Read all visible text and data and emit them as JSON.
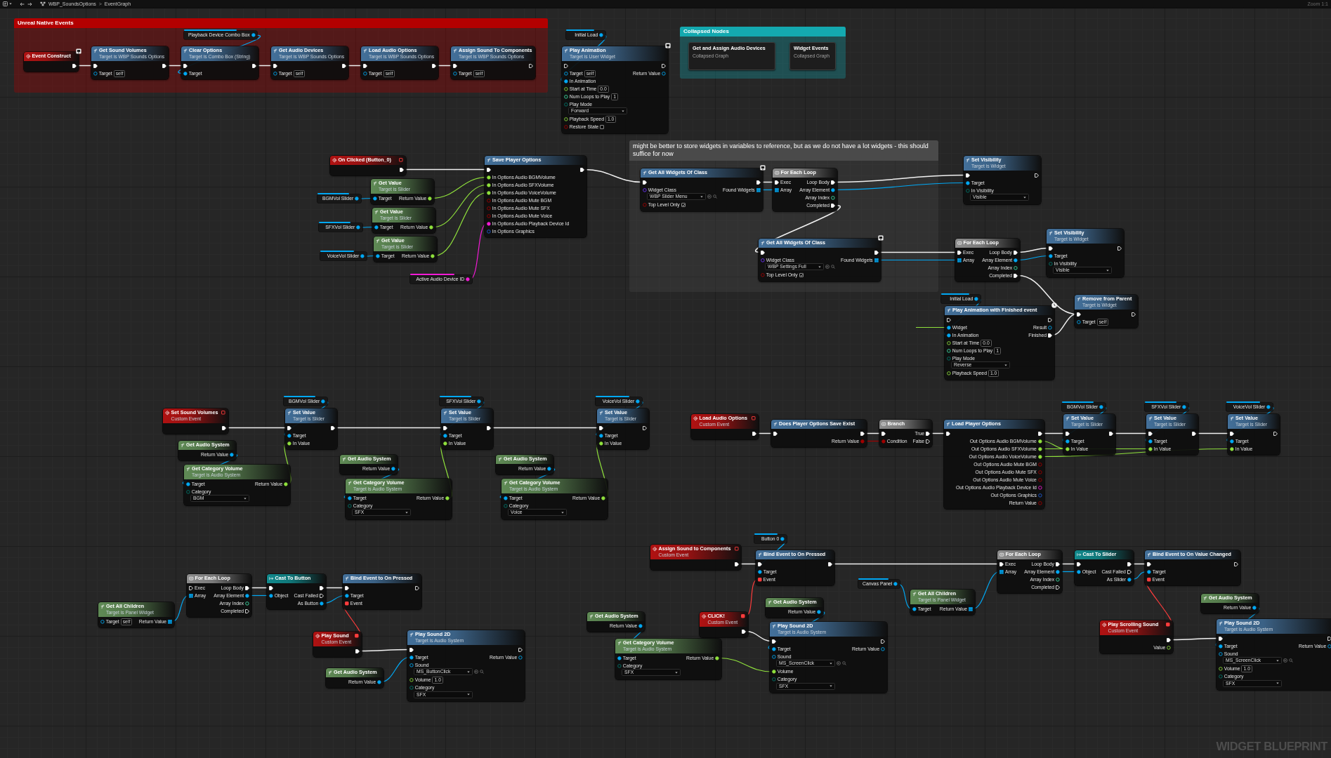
{
  "toolbar": {
    "path": [
      "WBP_SoundsOptions",
      "EventGraph"
    ],
    "separator": ">",
    "zoom": "Zoom 1:1"
  },
  "comments": [
    {
      "title": "Unreal Native Events",
      "color": "#b30000"
    },
    {
      "title": "Collapsed Nodes",
      "color": "#14a9b0"
    },
    {
      "title": "might be better to store widgets in variables to reference, but as we do not have a lot widgets - this should suffice for now",
      "color": "#4a4a4a"
    }
  ],
  "nodes": [
    {
      "kind": "event",
      "title": "Event Construct",
      "outputs": [
        {
          "kind": "exec",
          "linked": true
        }
      ]
    },
    {
      "kind": "function",
      "title": "Get Sound Volumes",
      "subtitle": "Target is WBP Sounds Options",
      "inputs": [
        {
          "kind": "exec",
          "linked": true
        },
        {
          "kind": "object",
          "label": "Target",
          "value": "self",
          "linked": false
        }
      ],
      "outputs": [
        {
          "kind": "exec",
          "linked": true
        }
      ]
    },
    {
      "kind": "getter",
      "title": "Playback Device Combo Box",
      "outputs": [
        {
          "kind": "object",
          "linked": true
        }
      ]
    },
    {
      "kind": "function",
      "title": "Clear Options",
      "subtitle": "Target is Combo Box (String)",
      "inputs": [
        {
          "kind": "exec",
          "linked": true
        },
        {
          "kind": "object",
          "label": "Target",
          "linked": true
        }
      ],
      "outputs": [
        {
          "kind": "exec",
          "linked": true
        }
      ]
    },
    {
      "kind": "function",
      "title": "Get Audio Devices",
      "subtitle": "Target is WBP Sounds Options",
      "inputs": [
        {
          "kind": "exec",
          "linked": true
        },
        {
          "kind": "object",
          "label": "Target",
          "value": "self",
          "linked": false
        }
      ],
      "outputs": [
        {
          "kind": "exec",
          "linked": true
        }
      ]
    },
    {
      "kind": "function",
      "title": "Load Audio Options",
      "subtitle": "Target is WBP Sounds Options",
      "inputs": [
        {
          "kind": "exec",
          "linked": true
        },
        {
          "kind": "object",
          "label": "Target",
          "value": "self",
          "linked": false
        }
      ],
      "outputs": [
        {
          "kind": "exec",
          "linked": true
        }
      ]
    },
    {
      "kind": "function",
      "title": "Assign Sound To Components",
      "subtitle": "Target is WBP Sounds Options",
      "inputs": [
        {
          "kind": "exec",
          "linked": true
        },
        {
          "kind": "object",
          "label": "Target",
          "value": "self",
          "linked": false
        }
      ],
      "outputs": [
        {
          "kind": "exec",
          "linked": false
        }
      ]
    },
    {
      "kind": "getter",
      "title": "Initial Load",
      "outputs": [
        {
          "kind": "object",
          "linked": true
        }
      ]
    },
    {
      "kind": "function",
      "title": "Play Animation",
      "subtitle": "Target is User Widget",
      "inputs": [
        {
          "kind": "exec",
          "linked": false
        },
        {
          "kind": "object",
          "label": "Target",
          "value": "self",
          "linked": false
        },
        {
          "kind": "object",
          "label": "In Animation",
          "linked": true
        },
        {
          "kind": "float",
          "label": "Start at Time",
          "value": "0.0",
          "linked": false
        },
        {
          "kind": "int",
          "label": "Num Loops to Play",
          "value": "1",
          "linked": false
        },
        {
          "kind": "enum",
          "label": "Play Mode",
          "value": "Forward",
          "linked": false
        },
        {
          "kind": "float",
          "label": "Playback Speed",
          "value": "1.0",
          "linked": false
        },
        {
          "kind": "bool",
          "label": "Restore State",
          "checked": false,
          "linked": false
        }
      ],
      "outputs": [
        {
          "kind": "exec",
          "linked": false
        },
        {
          "kind": "object",
          "label": "Return Value",
          "linked": false
        }
      ]
    },
    {
      "kind": "collapsed",
      "title": "Get and Assign Audio Devices",
      "subtitle": "Collapsed Graph"
    },
    {
      "kind": "collapsed",
      "title": "Widget Events",
      "subtitle": "Collapsed Graph"
    },
    {
      "kind": "event",
      "title": "On Clicked (Button_0)",
      "delegate": {
        "linked": false
      },
      "outputs": [
        {
          "kind": "exec",
          "linked": true
        }
      ]
    },
    {
      "kind": "getter",
      "title": "BGMVol Slider",
      "outputs": [
        {
          "kind": "object",
          "linked": true
        }
      ]
    },
    {
      "kind": "getter",
      "title": "SFXVol Slider",
      "outputs": [
        {
          "kind": "object",
          "linked": true
        }
      ]
    },
    {
      "kind": "getter",
      "title": "VoiceVol Slider",
      "outputs": [
        {
          "kind": "object",
          "linked": true
        }
      ]
    },
    {
      "kind": "pure",
      "title": "Get Value",
      "subtitle": "Target is Slider",
      "inputs": [
        {
          "kind": "object",
          "label": "Target",
          "linked": true
        }
      ],
      "outputs": [
        {
          "kind": "float",
          "label": "Return Value",
          "linked": true
        }
      ]
    },
    {
      "kind": "pure",
      "title": "Get Value",
      "subtitle": "Target is Slider",
      "inputs": [
        {
          "kind": "object",
          "label": "Target",
          "linked": true
        }
      ],
      "outputs": [
        {
          "kind": "float",
          "label": "Return Value",
          "linked": true
        }
      ]
    },
    {
      "kind": "pure",
      "title": "Get Value",
      "subtitle": "Target is Slider",
      "inputs": [
        {
          "kind": "object",
          "label": "Target",
          "linked": true
        }
      ],
      "outputs": [
        {
          "kind": "float",
          "label": "Return Value",
          "linked": true
        }
      ]
    },
    {
      "kind": "getter",
      "title": "Active Audio Device ID",
      "outputs": [
        {
          "kind": "string",
          "linked": true
        }
      ]
    },
    {
      "kind": "function",
      "title": "Save Player Options",
      "inputs": [
        {
          "kind": "exec",
          "linked": true
        },
        {
          "kind": "float",
          "label": "In Options Audio BGMVolume",
          "linked": true
        },
        {
          "kind": "float",
          "label": "In Options Audio SFXVolume",
          "linked": true
        },
        {
          "kind": "float",
          "label": "In Options Audio VoiceVolume",
          "linked": true
        },
        {
          "kind": "bool",
          "label": "In Options Audio Mute BGM",
          "linked": false
        },
        {
          "kind": "bool",
          "label": "In Options Audio Mute SFX",
          "linked": false
        },
        {
          "kind": "bool",
          "label": "In Options Audio Mute Voice",
          "linked": false
        },
        {
          "kind": "string",
          "label": "In Options Audio Playback Device Id",
          "linked": true
        },
        {
          "kind": "struct",
          "label": "In Options Graphics",
          "linked": false
        }
      ],
      "outputs": [
        {
          "kind": "exec",
          "linked": true
        }
      ]
    },
    {
      "kind": "function",
      "title": "Get All Widgets Of Class",
      "inputs": [
        {
          "kind": "exec",
          "linked": true
        },
        {
          "kind": "class",
          "label": "Widget Class",
          "value": "WBP Slider Menu",
          "linked": false
        },
        {
          "kind": "bool",
          "label": "Top Level Only",
          "checked": true,
          "linked": false
        }
      ],
      "outputs": [
        {
          "kind": "exec",
          "linked": true
        },
        {
          "kind": "array",
          "label": "Found Widgets",
          "linked": true
        }
      ]
    },
    {
      "kind": "macro",
      "title": "For Each Loop",
      "inputs": [
        {
          "kind": "exec",
          "label": "Exec",
          "linked": true
        },
        {
          "kind": "array",
          "label": "Array",
          "linked": true
        }
      ],
      "outputs": [
        {
          "kind": "exec",
          "label": "Loop Body",
          "linked": true
        },
        {
          "kind": "object",
          "label": "Array Element",
          "linked": true
        },
        {
          "kind": "int",
          "label": "Array Index",
          "linked": false
        },
        {
          "kind": "exec",
          "label": "Completed",
          "linked": true
        }
      ]
    },
    {
      "kind": "function",
      "title": "Get All Widgets Of Class",
      "inputs": [
        {
          "kind": "exec",
          "linked": true
        },
        {
          "kind": "class",
          "label": "Widget Class",
          "value": "WBP Settings Full",
          "linked": false
        },
        {
          "kind": "bool",
          "label": "Top Level Only",
          "checked": true,
          "linked": false
        }
      ],
      "outputs": [
        {
          "kind": "exec",
          "linked": true
        },
        {
          "kind": "array",
          "label": "Found Widgets",
          "linked": true
        }
      ]
    },
    {
      "kind": "function",
      "title": "Set Visibility",
      "subtitle": "Target is Widget",
      "inputs": [
        {
          "kind": "exec",
          "linked": true
        },
        {
          "kind": "object",
          "label": "Target",
          "linked": true
        },
        {
          "kind": "enum",
          "label": "In Visibility",
          "value": "Visible",
          "linked": false
        }
      ],
      "outputs": [
        {
          "kind": "exec",
          "linked": false
        }
      ]
    },
    {
      "kind": "macro",
      "title": "For Each Loop",
      "inputs": [
        {
          "kind": "exec",
          "label": "Exec",
          "linked": true
        },
        {
          "kind": "array",
          "label": "Array",
          "linked": true
        }
      ],
      "outputs": [
        {
          "kind": "exec",
          "label": "Loop Body",
          "linked": true
        },
        {
          "kind": "object",
          "label": "Array Element",
          "linked": true
        },
        {
          "kind": "int",
          "label": "Array Index",
          "linked": false
        },
        {
          "kind": "exec",
          "label": "Completed",
          "linked": true
        }
      ]
    },
    {
      "kind": "function",
      "title": "Set Visibility",
      "subtitle": "Target is Widget",
      "inputs": [
        {
          "kind": "exec",
          "linked": true
        },
        {
          "kind": "object",
          "label": "Target",
          "linked": true
        },
        {
          "kind": "enum",
          "label": "In Visibility",
          "value": "Visible",
          "linked": false
        }
      ],
      "outputs": [
        {
          "kind": "exec",
          "linked": false
        }
      ]
    },
    {
      "kind": "getter",
      "title": "Initial Load",
      "outputs": [
        {
          "kind": "object",
          "linked": true
        }
      ]
    },
    {
      "kind": "function",
      "title": "Play Animation with Finished event",
      "inputs": [
        {
          "kind": "exec",
          "linked": false
        },
        {
          "kind": "object",
          "label": "Widget",
          "linked": true
        },
        {
          "kind": "object",
          "label": "In Animation",
          "linked": true
        },
        {
          "kind": "float",
          "label": "Start at Time",
          "value": "0.0",
          "linked": false
        },
        {
          "kind": "int",
          "label": "Num Loops to Play",
          "value": "1",
          "linked": false
        },
        {
          "kind": "enum",
          "label": "Play Mode",
          "value": "Reverse",
          "linked": false
        },
        {
          "kind": "float",
          "label": "Playback Speed",
          "value": "1.0",
          "linked": false
        }
      ],
      "outputs": [
        {
          "kind": "exec",
          "linked": false
        },
        {
          "kind": "object",
          "label": "Result",
          "linked": false
        },
        {
          "kind": "exec",
          "label": "Finished",
          "linked": true
        }
      ]
    },
    {
      "kind": "function",
      "title": "Remove from Parent",
      "subtitle": "Target is Widget",
      "inputs": [
        {
          "kind": "exec",
          "linked": true
        },
        {
          "kind": "object",
          "label": "Target",
          "value": "self",
          "linked": false
        }
      ],
      "outputs": [
        {
          "kind": "exec",
          "linked": false
        }
      ]
    },
    {
      "kind": "event",
      "title": "Set Sound Volumes",
      "subtitle": "Custom Event",
      "delegate": {
        "linked": false
      },
      "outputs": [
        {
          "kind": "exec",
          "linked": true
        }
      ]
    },
    {
      "kind": "pure",
      "title": "Get Audio System",
      "outputs": [
        {
          "kind": "object",
          "label": "Return Value",
          "linked": true
        }
      ]
    },
    {
      "kind": "pure",
      "title": "Get Category Volume",
      "subtitle": "Target is Audio System",
      "inputs": [
        {
          "kind": "object",
          "label": "Target",
          "linked": true
        },
        {
          "kind": "enum",
          "label": "Category",
          "value": "BGM",
          "linked": false
        }
      ],
      "outputs": [
        {
          "kind": "float",
          "label": "Return Value",
          "linked": true
        }
      ]
    },
    {
      "kind": "getter",
      "title": "BGMVol Slider",
      "outputs": [
        {
          "kind": "object",
          "linked": true
        }
      ]
    },
    {
      "kind": "function",
      "title": "Set Value",
      "subtitle": "Target is Slider",
      "inputs": [
        {
          "kind": "exec",
          "linked": true
        },
        {
          "kind": "object",
          "label": "Target",
          "linked": true
        },
        {
          "kind": "float",
          "label": "In Value",
          "linked": true
        }
      ],
      "outputs": [
        {
          "kind": "exec",
          "linked": true
        }
      ]
    },
    {
      "kind": "pure",
      "title": "Get Audio System",
      "outputs": [
        {
          "kind": "object",
          "label": "Return Value",
          "linked": true
        }
      ]
    },
    {
      "kind": "pure",
      "title": "Get Category Volume",
      "subtitle": "Target is Audio System",
      "inputs": [
        {
          "kind": "object",
          "label": "Target",
          "linked": true
        },
        {
          "kind": "enum",
          "label": "Category",
          "value": "SFX",
          "linked": false
        }
      ],
      "outputs": [
        {
          "kind": "float",
          "label": "Return Value",
          "linked": true
        }
      ]
    },
    {
      "kind": "getter",
      "title": "SFXVol Slider",
      "outputs": [
        {
          "kind": "object",
          "linked": true
        }
      ]
    },
    {
      "kind": "function",
      "title": "Set Value",
      "subtitle": "Target is Slider",
      "inputs": [
        {
          "kind": "exec",
          "linked": true
        },
        {
          "kind": "object",
          "label": "Target",
          "linked": true
        },
        {
          "kind": "float",
          "label": "In Value",
          "linked": true
        }
      ],
      "outputs": [
        {
          "kind": "exec",
          "linked": true
        }
      ]
    },
    {
      "kind": "pure",
      "title": "Get Audio System",
      "outputs": [
        {
          "kind": "object",
          "label": "Return Value",
          "linked": true
        }
      ]
    },
    {
      "kind": "pure",
      "title": "Get Category Volume",
      "subtitle": "Target is Audio System",
      "inputs": [
        {
          "kind": "object",
          "label": "Target",
          "linked": true
        },
        {
          "kind": "enum",
          "label": "Category",
          "value": "Voice",
          "linked": false
        }
      ],
      "outputs": [
        {
          "kind": "float",
          "label": "Return Value",
          "linked": true
        }
      ]
    },
    {
      "kind": "getter",
      "title": "VoiceVol Slider",
      "outputs": [
        {
          "kind": "object",
          "linked": true
        }
      ]
    },
    {
      "kind": "function",
      "title": "Set Value",
      "subtitle": "Target is Slider",
      "inputs": [
        {
          "kind": "exec",
          "linked": true
        },
        {
          "kind": "object",
          "label": "Target",
          "linked": true
        },
        {
          "kind": "float",
          "label": "In Value",
          "linked": true
        }
      ],
      "outputs": [
        {
          "kind": "exec",
          "linked": false
        }
      ]
    },
    {
      "kind": "event",
      "title": "Load Audio Options",
      "subtitle": "Custom Event",
      "delegate": {
        "linked": false
      },
      "outputs": [
        {
          "kind": "exec",
          "linked": true
        }
      ]
    },
    {
      "kind": "function",
      "title": "Does Player Options Save Exist",
      "inputs": [
        {
          "kind": "exec",
          "linked": true
        }
      ],
      "outputs": [
        {
          "kind": "exec",
          "linked": true
        },
        {
          "kind": "bool",
          "label": "Return Value",
          "linked": true
        }
      ]
    },
    {
      "kind": "macro",
      "title": "Branch",
      "inputs": [
        {
          "kind": "exec",
          "linked": true
        },
        {
          "kind": "bool",
          "label": "Condition",
          "linked": true
        }
      ],
      "outputs": [
        {
          "kind": "exec",
          "label": "True",
          "linked": true
        },
        {
          "kind": "exec",
          "label": "False",
          "linked": false
        }
      ]
    },
    {
      "kind": "function",
      "title": "Load Player Options",
      "inputs": [
        {
          "kind": "exec",
          "linked": true
        }
      ],
      "outputs": [
        {
          "kind": "exec",
          "linked": true
        },
        {
          "kind": "float",
          "label": "Out Options Audio BGMVolume",
          "linked": true
        },
        {
          "kind": "float",
          "label": "Out Options Audio SFXVolume",
          "linked": true
        },
        {
          "kind": "float",
          "label": "Out Options Audio VoiceVolume",
          "linked": true
        },
        {
          "kind": "bool",
          "label": "Out Options Audio Mute BGM",
          "linked": false
        },
        {
          "kind": "bool",
          "label": "Out Options Audio Mute SFX",
          "linked": false
        },
        {
          "kind": "bool",
          "label": "Out Options Audio Mute Voice",
          "linked": false
        },
        {
          "kind": "string",
          "label": "Out Options Audio Playback Device Id",
          "linked": false
        },
        {
          "kind": "struct",
          "label": "Out Options Graphics",
          "linked": false
        },
        {
          "kind": "bool",
          "label": "Return Value",
          "linked": false
        }
      ]
    },
    {
      "kind": "getter",
      "title": "BGMVol Slider",
      "outputs": [
        {
          "kind": "object",
          "linked": true
        }
      ]
    },
    {
      "kind": "function",
      "title": "Set Value",
      "subtitle": "Target is Slider",
      "inputs": [
        {
          "kind": "exec",
          "linked": true
        },
        {
          "kind": "object",
          "label": "Target",
          "linked": true
        },
        {
          "kind": "float",
          "label": "In Value",
          "linked": true
        }
      ],
      "outputs": [
        {
          "kind": "exec",
          "linked": true
        }
      ]
    },
    {
      "kind": "getter",
      "title": "SFXVol Slider",
      "outputs": [
        {
          "kind": "object",
          "linked": true
        }
      ]
    },
    {
      "kind": "function",
      "title": "Set Value",
      "subtitle": "Target is Slider",
      "inputs": [
        {
          "kind": "exec",
          "linked": true
        },
        {
          "kind": "object",
          "label": "Target",
          "linked": true
        },
        {
          "kind": "float",
          "label": "In Value",
          "linked": true
        }
      ],
      "outputs": [
        {
          "kind": "exec",
          "linked": true
        }
      ]
    },
    {
      "kind": "getter",
      "title": "VoiceVol Slider",
      "outputs": [
        {
          "kind": "object",
          "linked": true
        }
      ]
    },
    {
      "kind": "function",
      "title": "Set Value",
      "subtitle": "Target is Slider",
      "inputs": [
        {
          "kind": "exec",
          "linked": true
        },
        {
          "kind": "object",
          "label": "Target",
          "linked": true
        },
        {
          "kind": "float",
          "label": "In Value",
          "linked": true
        }
      ],
      "outputs": [
        {
          "kind": "exec",
          "linked": false
        }
      ]
    },
    {
      "kind": "pure",
      "title": "Get All Children",
      "subtitle": "Target is Panel Widget",
      "inputs": [
        {
          "kind": "object",
          "label": "Target",
          "value": "self",
          "linked": false
        }
      ],
      "outputs": [
        {
          "kind": "array",
          "label": "Return Value",
          "linked": true
        }
      ]
    },
    {
      "kind": "macro",
      "title": "For Each Loop",
      "inputs": [
        {
          "kind": "exec",
          "label": "Exec",
          "linked": false
        },
        {
          "kind": "array",
          "label": "Array",
          "linked": true
        }
      ],
      "outputs": [
        {
          "kind": "exec",
          "label": "Loop Body",
          "linked": true
        },
        {
          "kind": "object",
          "label": "Array Element",
          "linked": true
        },
        {
          "kind": "int",
          "label": "Array Index",
          "linked": false
        },
        {
          "kind": "exec",
          "label": "Completed",
          "linked": false
        }
      ]
    },
    {
      "kind": "cast",
      "title": "Cast To Button",
      "inputs": [
        {
          "kind": "exec",
          "linked": true
        },
        {
          "kind": "object",
          "label": "Object",
          "linked": true
        }
      ],
      "outputs": [
        {
          "kind": "exec",
          "linked": true
        },
        {
          "kind": "exec",
          "label": "Cast Failed",
          "linked": false
        },
        {
          "kind": "object",
          "label": "As Button",
          "linked": true
        }
      ]
    },
    {
      "kind": "function",
      "title": "Bind Event to On Pressed",
      "inputs": [
        {
          "kind": "exec",
          "linked": true
        },
        {
          "kind": "object",
          "label": "Target",
          "linked": true
        },
        {
          "kind": "delegate",
          "label": "Event",
          "linked": true
        }
      ],
      "outputs": [
        {
          "kind": "exec",
          "linked": false
        }
      ]
    },
    {
      "kind": "event",
      "title": "Play Sound",
      "subtitle": "Custom Event",
      "delegate": {
        "linked": true
      },
      "outputs": [
        {
          "kind": "exec",
          "linked": true
        }
      ]
    },
    {
      "kind": "pure",
      "title": "Get Audio System",
      "outputs": [
        {
          "kind": "object",
          "label": "Return Value",
          "linked": true
        }
      ]
    },
    {
      "kind": "function",
      "title": "Play Sound 2D",
      "subtitle": "Target is Audio System",
      "inputs": [
        {
          "kind": "exec",
          "linked": true
        },
        {
          "kind": "object",
          "label": "Target",
          "linked": true
        },
        {
          "kind": "asset",
          "label": "Sound",
          "value": "MS_ButtonClick",
          "linked": false
        },
        {
          "kind": "float",
          "label": "Volume",
          "value": "1.0",
          "linked": false
        },
        {
          "kind": "enum",
          "label": "Category",
          "value": "SFX",
          "linked": false
        }
      ],
      "outputs": [
        {
          "kind": "exec",
          "linked": false
        },
        {
          "kind": "object",
          "label": "Return Value",
          "linked": false
        }
      ]
    },
    {
      "kind": "event",
      "title": "Assign Sound to Components",
      "subtitle": "Custom Event",
      "delegate": {
        "linked": false
      },
      "outputs": [
        {
          "kind": "exec",
          "linked": true
        }
      ]
    },
    {
      "kind": "pure",
      "title": "Get Audio System",
      "outputs": [
        {
          "kind": "object",
          "label": "Return Value",
          "linked": true
        }
      ]
    },
    {
      "kind": "pure",
      "title": "Get Category Volume",
      "subtitle": "Target is Audio System",
      "inputs": [
        {
          "kind": "object",
          "label": "Target",
          "linked": true
        },
        {
          "kind": "enum",
          "label": "Category",
          "value": "SFX",
          "linked": false
        }
      ],
      "outputs": [
        {
          "kind": "float",
          "label": "Return Value",
          "linked": true
        }
      ]
    },
    {
      "kind": "event",
      "title": "CLICK!",
      "subtitle": "Custom Event",
      "delegate": {
        "linked": true
      },
      "outputs": [
        {
          "kind": "exec",
          "linked": true
        }
      ]
    },
    {
      "kind": "getter",
      "title": "Button 0",
      "outputs": [
        {
          "kind": "object",
          "linked": true
        }
      ]
    },
    {
      "kind": "function",
      "title": "Bind Event to On Pressed",
      "inputs": [
        {
          "kind": "exec",
          "linked": true
        },
        {
          "kind": "object",
          "label": "Target",
          "linked": true
        },
        {
          "kind": "delegate",
          "label": "Event",
          "linked": true
        }
      ],
      "outputs": [
        {
          "kind": "exec",
          "linked": true
        }
      ]
    },
    {
      "kind": "pure",
      "title": "Get Audio System",
      "outputs": [
        {
          "kind": "object",
          "label": "Return Value",
          "linked": true
        }
      ]
    },
    {
      "kind": "function",
      "title": "Play Sound 2D",
      "subtitle": "Target is Audio System",
      "inputs": [
        {
          "kind": "exec",
          "linked": true
        },
        {
          "kind": "object",
          "label": "Target",
          "linked": true
        },
        {
          "kind": "asset",
          "label": "Sound",
          "value": "MS_ScreenClick",
          "linked": false
        },
        {
          "kind": "float",
          "label": "Volume",
          "linked": true
        },
        {
          "kind": "enum",
          "label": "Category",
          "value": "SFX",
          "linked": false
        }
      ],
      "outputs": [
        {
          "kind": "exec",
          "linked": false
        },
        {
          "kind": "object",
          "label": "Return Value",
          "linked": false
        }
      ]
    },
    {
      "kind": "getter",
      "title": "Canvas Panel",
      "outputs": [
        {
          "kind": "object",
          "linked": true
        }
      ]
    },
    {
      "kind": "pure",
      "title": "Get All Children",
      "subtitle": "Target is Panel Widget",
      "inputs": [
        {
          "kind": "object",
          "label": "Target",
          "linked": true
        }
      ],
      "outputs": [
        {
          "kind": "array",
          "label": "Return Value",
          "linked": true
        }
      ]
    },
    {
      "kind": "macro",
      "title": "For Each Loop",
      "inputs": [
        {
          "kind": "exec",
          "label": "Exec",
          "linked": true
        },
        {
          "kind": "array",
          "label": "Array",
          "linked": true
        }
      ],
      "outputs": [
        {
          "kind": "exec",
          "label": "Loop Body",
          "linked": true
        },
        {
          "kind": "object",
          "label": "Array Element",
          "linked": true
        },
        {
          "kind": "int",
          "label": "Array Index",
          "linked": false
        },
        {
          "kind": "exec",
          "label": "Completed",
          "linked": false
        }
      ]
    },
    {
      "kind": "cast",
      "title": "Cast To Slider",
      "inputs": [
        {
          "kind": "exec",
          "linked": true
        },
        {
          "kind": "object",
          "label": "Object",
          "linked": true
        }
      ],
      "outputs": [
        {
          "kind": "exec",
          "linked": true
        },
        {
          "kind": "exec",
          "label": "Cast Failed",
          "linked": false
        },
        {
          "kind": "object",
          "label": "As Slider",
          "linked": true
        }
      ]
    },
    {
      "kind": "function",
      "title": "Bind Event to On Value Changed",
      "inputs": [
        {
          "kind": "exec",
          "linked": true
        },
        {
          "kind": "object",
          "label": "Target",
          "linked": true
        },
        {
          "kind": "delegate",
          "label": "Event",
          "linked": true
        }
      ],
      "outputs": [
        {
          "kind": "exec",
          "linked": false
        }
      ]
    },
    {
      "kind": "event",
      "title": "Play Scrolling Sound",
      "subtitle": "Custom Event",
      "delegate": {
        "linked": true
      },
      "outputs": [
        {
          "kind": "exec",
          "linked": true
        },
        {
          "kind": "float",
          "label": "Value",
          "linked": false
        }
      ]
    },
    {
      "kind": "pure",
      "title": "Get Audio System",
      "outputs": [
        {
          "kind": "object",
          "label": "Return Value",
          "linked": true
        }
      ]
    },
    {
      "kind": "function",
      "title": "Play Sound 2D",
      "subtitle": "Target is Audio System",
      "inputs": [
        {
          "kind": "exec",
          "linked": true
        },
        {
          "kind": "object",
          "label": "Target",
          "linked": true
        },
        {
          "kind": "asset",
          "label": "Sound",
          "value": "MS_ScreenClick",
          "linked": false
        },
        {
          "kind": "float",
          "label": "Volume",
          "value": "1.0",
          "linked": false
        },
        {
          "kind": "enum",
          "label": "Category",
          "value": "SFX",
          "linked": false
        }
      ],
      "outputs": [
        {
          "kind": "exec",
          "linked": false
        },
        {
          "kind": "object",
          "label": "Return Value",
          "linked": false
        }
      ]
    }
  ],
  "watermark": "WIDGET BLUEPRINT"
}
